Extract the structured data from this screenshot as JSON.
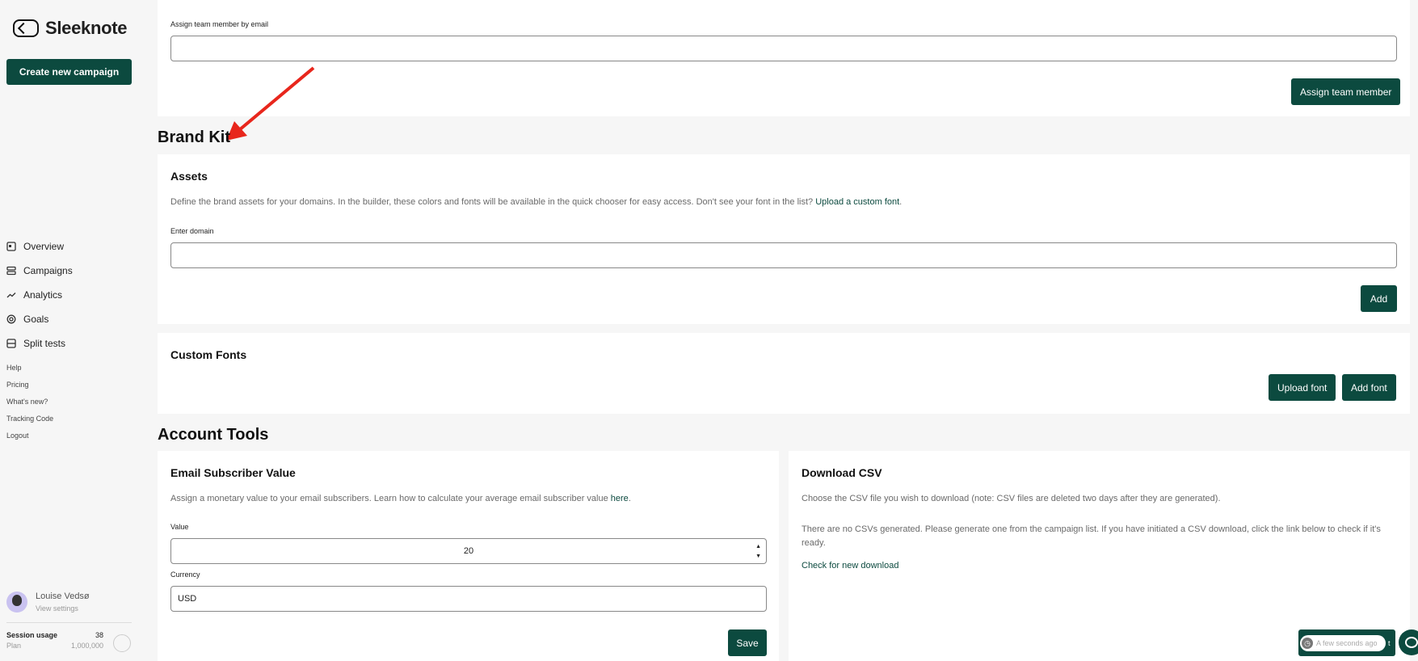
{
  "app": {
    "name": "Sleeknote"
  },
  "sidebar": {
    "create_button": "Create new campaign",
    "nav": [
      {
        "label": "Overview",
        "icon": "overview-icon"
      },
      {
        "label": "Campaigns",
        "icon": "campaigns-icon"
      },
      {
        "label": "Analytics",
        "icon": "analytics-icon"
      },
      {
        "label": "Goals",
        "icon": "goals-icon"
      },
      {
        "label": "Split tests",
        "icon": "split-tests-icon"
      }
    ],
    "links": [
      "Help",
      "Pricing",
      "What's new?",
      "Tracking Code",
      "Logout"
    ],
    "user": {
      "name": "Louise Vedsø",
      "sub": "View settings"
    },
    "session": {
      "label": "Session usage",
      "value": "38",
      "plan_label": "Plan",
      "plan_value": "1,000,000"
    }
  },
  "team": {
    "label": "Assign team member by email",
    "input_value": "",
    "button": "Assign team member"
  },
  "brand_kit": {
    "title": "Brand Kit",
    "assets": {
      "title": "Assets",
      "description": "Define the brand assets for your domains. In the builder, these colors and fonts will be available in the quick chooser for easy access. Don't see your font in the list?",
      "link": "Upload a custom font",
      "domain_label": "Enter domain",
      "domain_value": "",
      "add_button": "Add"
    },
    "fonts": {
      "title": "Custom Fonts",
      "upload_button": "Upload font",
      "add_button": "Add font"
    }
  },
  "account_tools": {
    "title": "Account Tools",
    "subscriber": {
      "title": "Email Subscriber Value",
      "description": "Assign a monetary value to your email subscribers. Learn how to calculate your average email subscriber value",
      "link": "here",
      "value_label": "Value",
      "value": "20",
      "currency_label": "Currency",
      "currency": "USD",
      "save_button": "Save"
    },
    "csv": {
      "title": "Download CSV",
      "description": "Choose the CSV file you wish to download (note: CSV files are deleted two days after they are generated).",
      "empty_text": "There are no CSVs generated. Please generate one from the campaign list. If you have initiated a CSV download, click the link below to check if it's ready.",
      "check_link": "Check for new download"
    }
  },
  "toast": {
    "text": "A few seconds ago",
    "tail": "t"
  },
  "colors": {
    "accent": "#0c4a3f",
    "background": "#f6f6f6"
  }
}
